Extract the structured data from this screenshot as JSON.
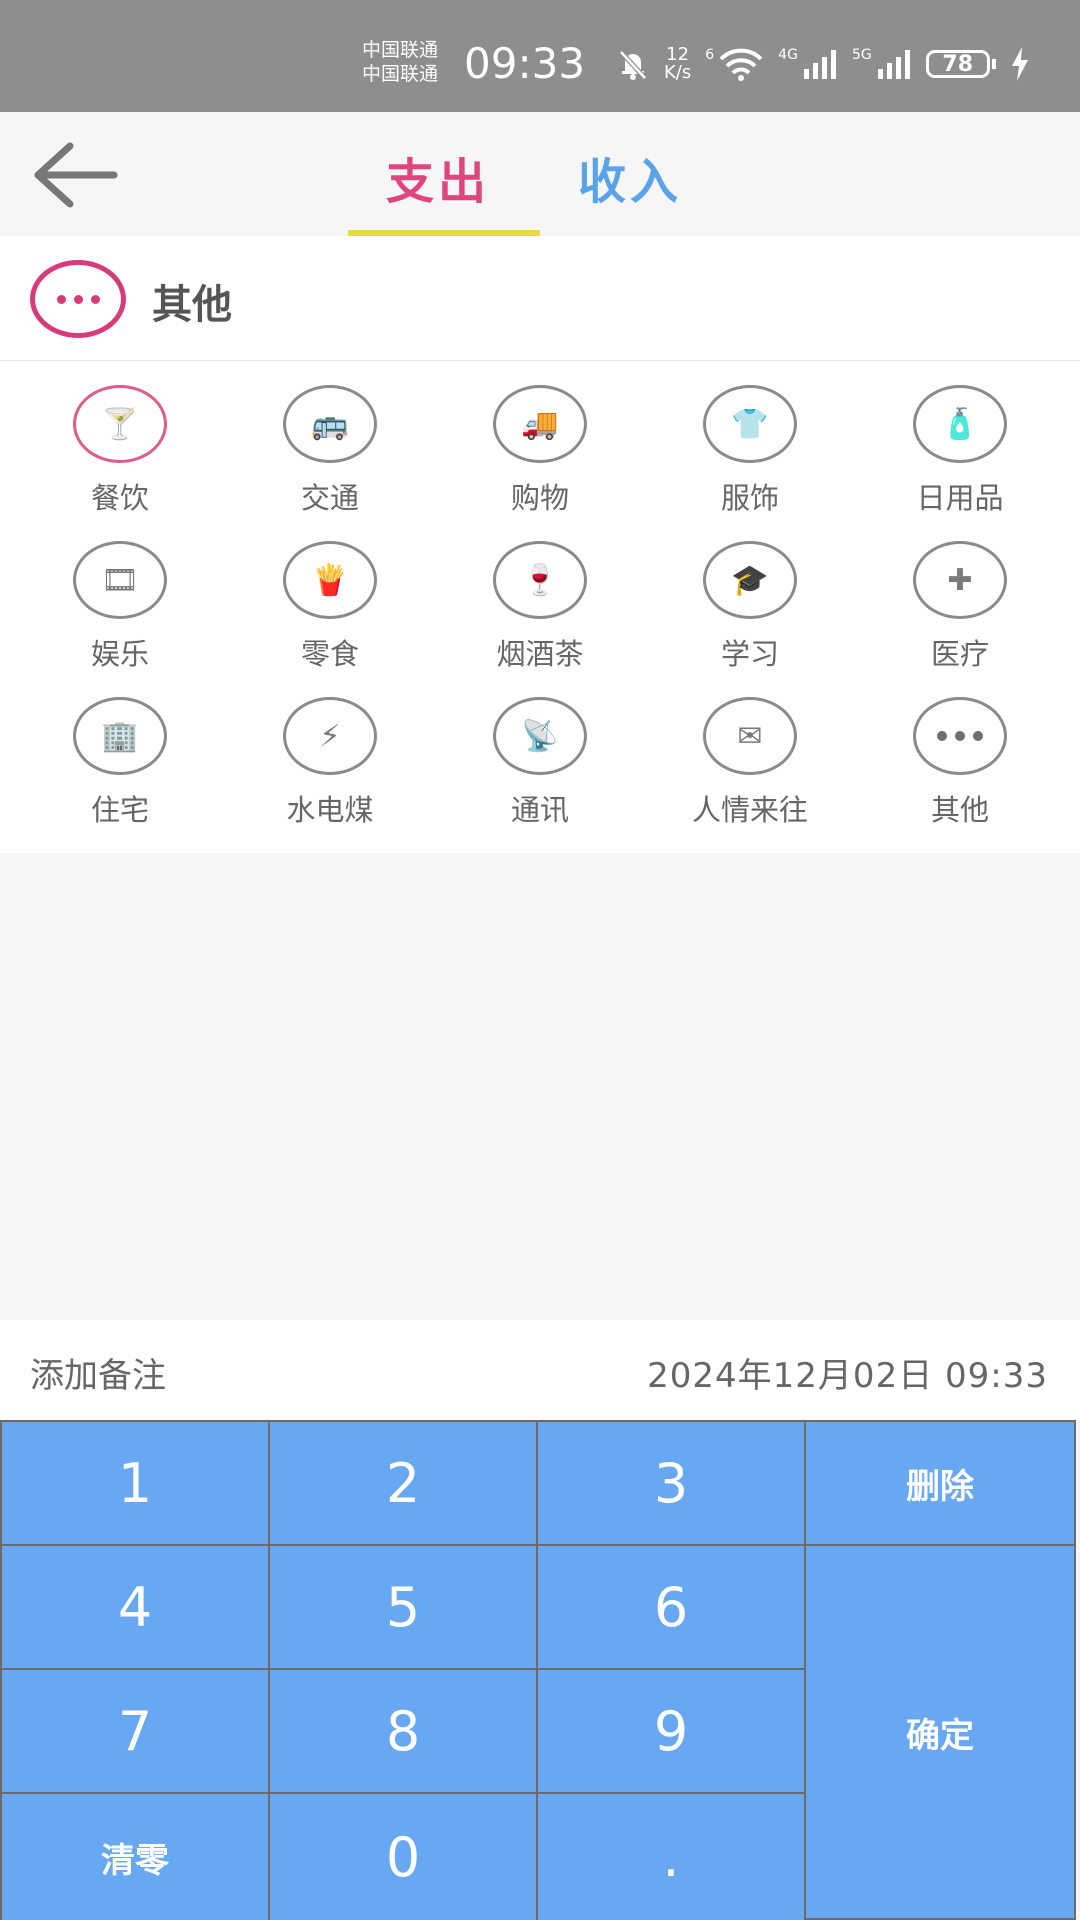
{
  "status_bar": {
    "carrier_1": "中国联通",
    "carrier_2": "中国联通",
    "time": "09:33",
    "net_speed_top": "12",
    "net_speed_bottom": "K/s",
    "wifi_label": "6",
    "sig1": "4G",
    "sig2": "5G",
    "battery": "78"
  },
  "header": {
    "tabs": [
      {
        "label": "支出",
        "active": true
      },
      {
        "label": "收入",
        "active": false
      }
    ],
    "colors": {
      "expense": "#e0457d",
      "income": "#5aa3ea",
      "underline": "#e8dc3c"
    }
  },
  "selected_category": {
    "label": "其他",
    "icon": "more-icon"
  },
  "categories": [
    {
      "label": "餐饮",
      "icon": "dining-icon",
      "glyph": "🍸"
    },
    {
      "label": "交通",
      "icon": "bus-icon",
      "glyph": "🚌"
    },
    {
      "label": "购物",
      "icon": "truck-icon",
      "glyph": "🚚"
    },
    {
      "label": "服饰",
      "icon": "tshirt-icon",
      "glyph": "👕"
    },
    {
      "label": "日用品",
      "icon": "toiletries-icon",
      "glyph": "🧴"
    },
    {
      "label": "娱乐",
      "icon": "film-reel-icon",
      "glyph": "🎞"
    },
    {
      "label": "零食",
      "icon": "fries-icon",
      "glyph": "🍟"
    },
    {
      "label": "烟酒茶",
      "icon": "wine-icon",
      "glyph": "🍷"
    },
    {
      "label": "学习",
      "icon": "graduation-cap-icon",
      "glyph": "🎓"
    },
    {
      "label": "医疗",
      "icon": "medical-kit-icon",
      "glyph": "✚"
    },
    {
      "label": "住宅",
      "icon": "building-icon",
      "glyph": "🏢"
    },
    {
      "label": "水电煤",
      "icon": "utility-icon",
      "glyph": "⚡"
    },
    {
      "label": "通讯",
      "icon": "antenna-icon",
      "glyph": "📡"
    },
    {
      "label": "人情来往",
      "icon": "envelope-icon",
      "glyph": "✉"
    },
    {
      "label": "其他",
      "icon": "more-icon",
      "glyph": ""
    }
  ],
  "note_bar": {
    "note_label": "添加备注",
    "datetime": "2024年12月02日 09:33"
  },
  "keypad": {
    "k1": "1",
    "k2": "2",
    "k3": "3",
    "delete": "删除",
    "k4": "4",
    "k5": "5",
    "k6": "6",
    "confirm": "确定",
    "k7": "7",
    "k8": "8",
    "k9": "9",
    "clear": "清零",
    "k0": "0",
    "dot": "."
  }
}
